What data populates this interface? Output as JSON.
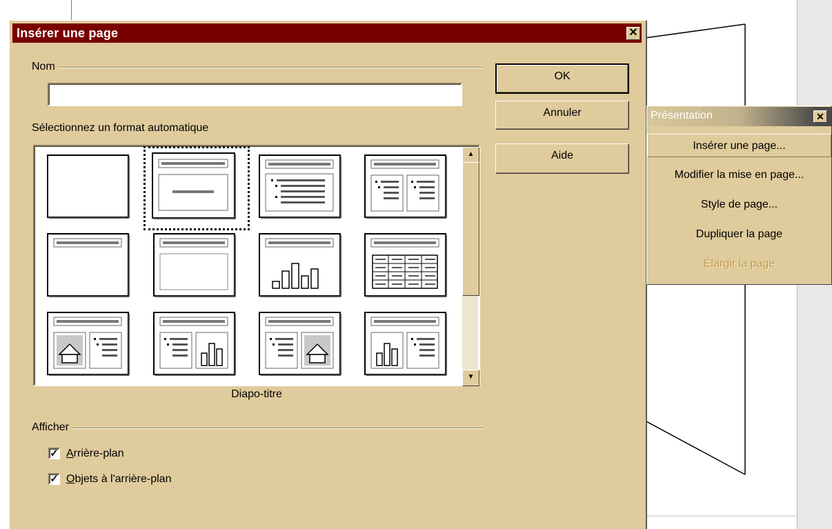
{
  "dialog": {
    "title": "Insérer une page",
    "close_label": "✕",
    "name_label": "Nom",
    "name_value": "",
    "format_label": "Sélectionnez un format automatique",
    "selected_layout": "Diapo-titre",
    "display_label": "Afficher",
    "buttons": {
      "ok": "OK",
      "cancel": "Annuler",
      "help": "Aide"
    },
    "checkboxes": [
      {
        "accel": "A",
        "rest": "rrière-plan",
        "checked": true
      },
      {
        "accel": "O",
        "rest": "bjets à l'arrière-plan",
        "checked": true
      }
    ],
    "layouts": [
      {
        "type": "blank"
      },
      {
        "type": "title-slide",
        "selected": true
      },
      {
        "type": "title-list"
      },
      {
        "type": "title-2-lists"
      },
      {
        "type": "title-only"
      },
      {
        "type": "title-content"
      },
      {
        "type": "title-chart"
      },
      {
        "type": "title-table"
      },
      {
        "type": "title-clipart-list"
      },
      {
        "type": "title-list-chart"
      },
      {
        "type": "title-list-clipart"
      },
      {
        "type": "title-chart-list"
      }
    ],
    "scroll_icons": {
      "up": "▲",
      "down": "▼"
    }
  },
  "panel": {
    "title": "Présentation",
    "close_label": "✕",
    "items": [
      {
        "label": "Insérer une page...",
        "enabled": true
      },
      {
        "label": "Modifier la mise en page...",
        "enabled": true
      },
      {
        "label": "Style de page...",
        "enabled": true
      },
      {
        "label": "Dupliquer la page",
        "enabled": true
      },
      {
        "label": "Élargir la page",
        "enabled": false
      }
    ]
  },
  "colors": {
    "face": "#dfcb9c",
    "titlebar": "#7a0000",
    "disabled": "#c09a48"
  }
}
